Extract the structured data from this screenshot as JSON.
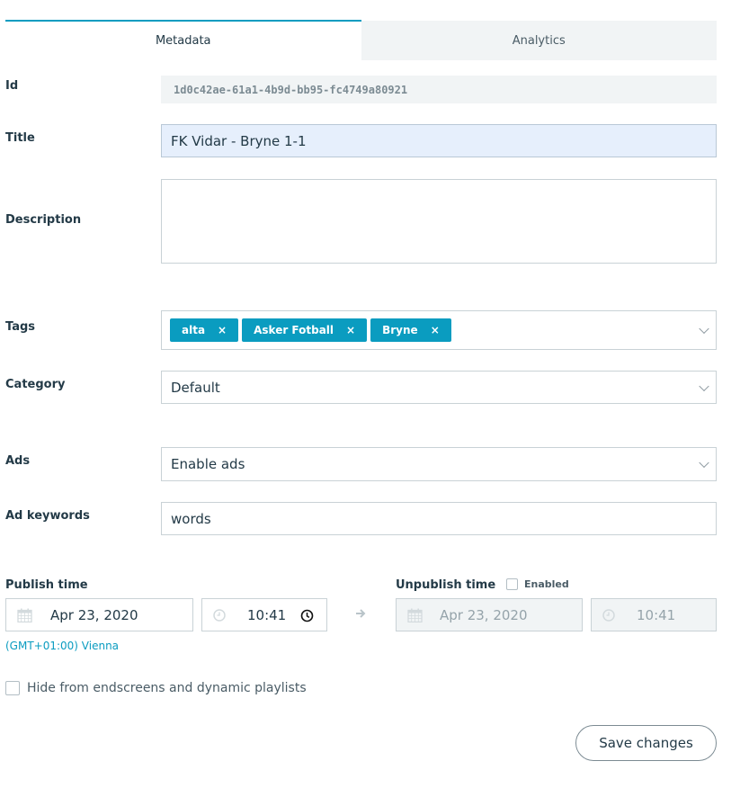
{
  "tabs": [
    {
      "label": "Metadata",
      "active": true
    },
    {
      "label": "Analytics",
      "active": false
    }
  ],
  "fields": {
    "id": {
      "label": "Id",
      "value": "1d0c42ae-61a1-4b9d-bb95-fc4749a80921"
    },
    "title": {
      "label": "Title",
      "value": "FK Vidar - Bryne 1-1"
    },
    "description": {
      "label": "Description",
      "value": ""
    },
    "tags": {
      "label": "Tags",
      "items": [
        "alta",
        "Asker Fotball",
        "Bryne"
      ],
      "remove_glyph": "×"
    },
    "category": {
      "label": "Category",
      "value": "Default"
    },
    "ads": {
      "label": "Ads",
      "value": "Enable ads"
    },
    "ad_keywords": {
      "label": "Ad keywords",
      "value": "words"
    }
  },
  "publish": {
    "label": "Publish time",
    "date": "Apr 23, 2020",
    "time": "10:41",
    "timezone": "(GMT+01:00) Vienna"
  },
  "unpublish": {
    "label": "Unpublish time",
    "enabled_label": "Enabled",
    "enabled": false,
    "date": "Apr 23, 2020",
    "time": "10:41"
  },
  "hide_option": {
    "label": "Hide from endscreens and dynamic playlists",
    "checked": false
  },
  "save_label": "Save changes",
  "colors": {
    "accent": "#0a9cc0",
    "text": "#233a47",
    "muted_bg": "#f1f4f5"
  }
}
